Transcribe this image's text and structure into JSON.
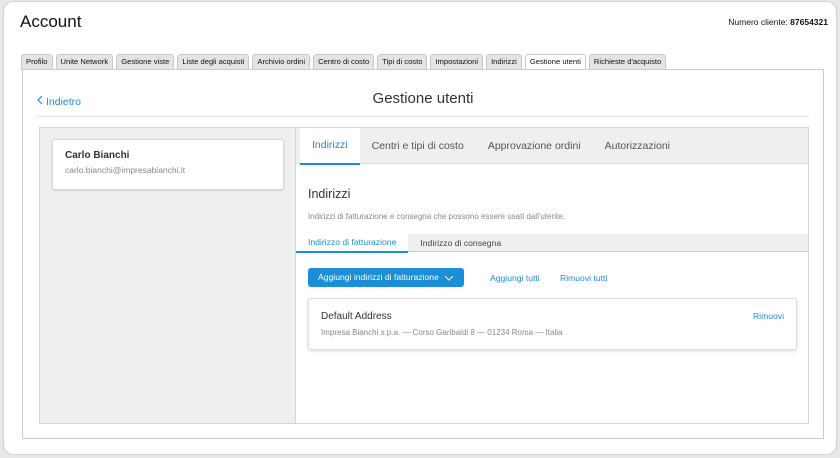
{
  "header": {
    "title": "Account",
    "customer_label": "Numero cliente:",
    "customer_number": "87654321"
  },
  "tabs": [
    {
      "label": "Profilo"
    },
    {
      "label": "Unite Network"
    },
    {
      "label": "Gestione viste"
    },
    {
      "label": "Liste degli acquisti"
    },
    {
      "label": "Archivio ordini"
    },
    {
      "label": "Centro di costo"
    },
    {
      "label": "Tipi di costo"
    },
    {
      "label": "Impostazioni"
    },
    {
      "label": "Indirizzi"
    },
    {
      "label": "Gestione utenti"
    },
    {
      "label": "Richieste d'acquisto"
    }
  ],
  "active_tab": "Gestione utenti",
  "page": {
    "back_label": "Indietro",
    "title": "Gestione utenti"
  },
  "user": {
    "name": "Carlo Bianchi",
    "email": "carlo.bianchi@impresabianchi.it"
  },
  "subnav": [
    {
      "label": "Indirizzi"
    },
    {
      "label": "Centri e tipi di costo"
    },
    {
      "label": "Approvazione ordini"
    },
    {
      "label": "Autorizzazioni"
    }
  ],
  "section": {
    "title": "Indirizzi",
    "description": "Indirizzi di fatturazione e consegna che possono essere usati dall'utente."
  },
  "address_tabs": [
    {
      "label": "Indirizzo di fatturazione"
    },
    {
      "label": "Indirizzo di consegna"
    }
  ],
  "actions": {
    "add_button": "Aggiungi indirizzi di fatturazione",
    "add_all": "Aggiungi tutti",
    "remove_all": "Rimuovi tutti"
  },
  "address": {
    "name": "Default Address",
    "line": "Impresa Bianchi s.p.a. — Corso Garibaldi 8 — 01234 Roma — Italia",
    "remove_label": "Rimuovi"
  },
  "colors": {
    "accent": "#1a8ed6",
    "panel_bg": "#efefef"
  }
}
